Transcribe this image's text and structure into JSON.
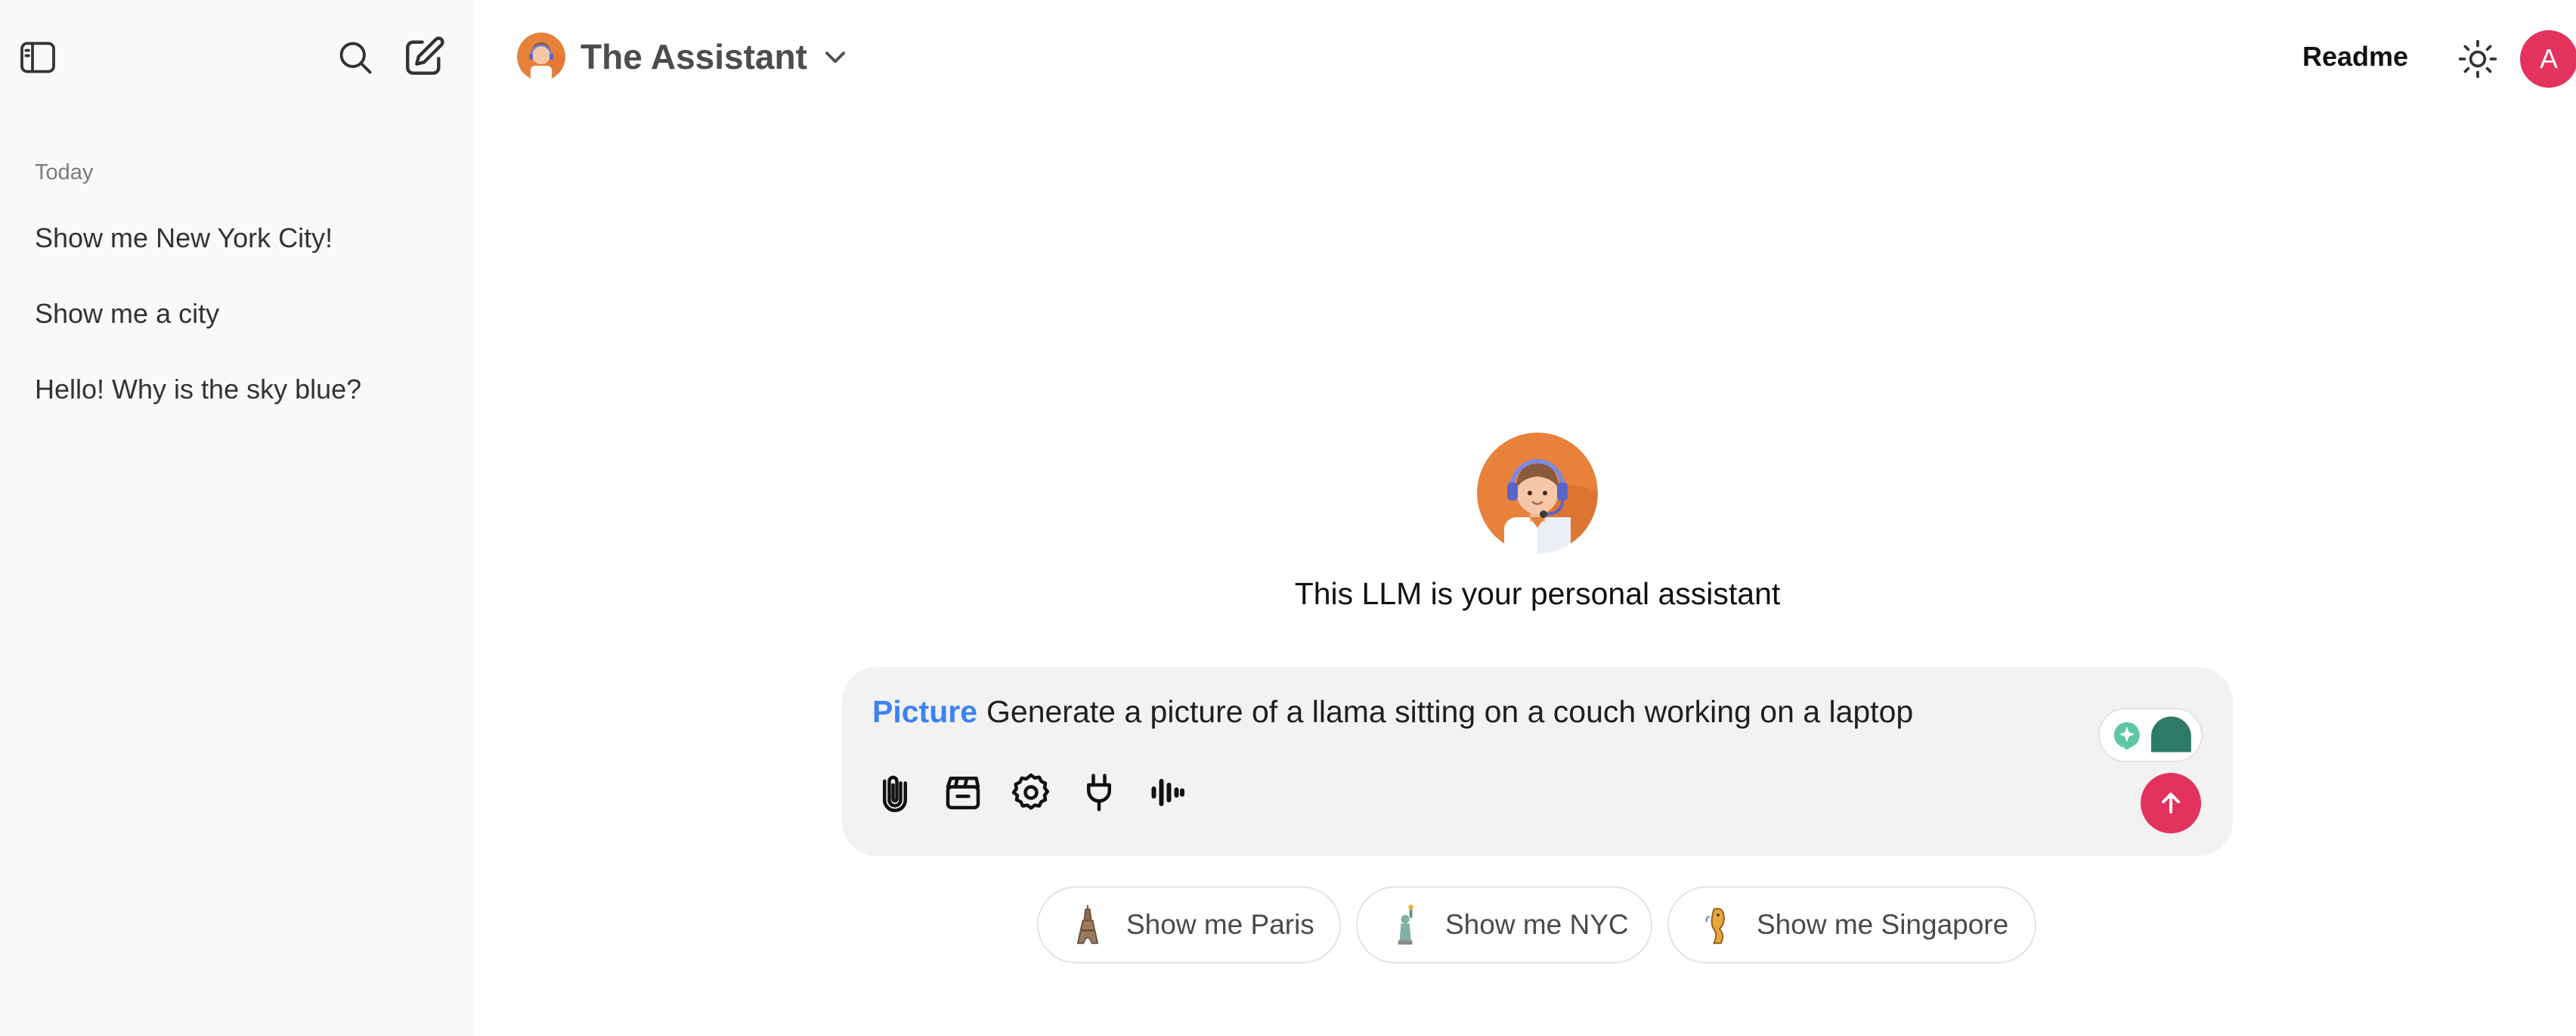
{
  "sidebar": {
    "toggle_icon": "sidebar-toggle-icon",
    "search_icon": "search-icon",
    "new_chat_icon": "new-chat-icon",
    "section_label": "Today",
    "items": [
      {
        "label": "Show me New York City!"
      },
      {
        "label": "Show me a city"
      },
      {
        "label": "Hello! Why is the sky blue?"
      }
    ]
  },
  "header": {
    "model_name": "The Assistant",
    "readme_label": "Readme",
    "theme_icon": "sun-icon",
    "user_initial": "A"
  },
  "main": {
    "description": "This LLM is your personal assistant",
    "composer": {
      "mode_label": "Picture",
      "input_text": "Generate a picture of a llama sitting on a couch working on a laptop",
      "tools": [
        "paperclip-icon",
        "clapperboard-icon",
        "gear-icon",
        "plug-icon",
        "audio-wave-icon"
      ]
    },
    "suggestions": [
      {
        "label": "Show me Paris",
        "icon": "eiffel-tower-icon"
      },
      {
        "label": "Show me NYC",
        "icon": "statue-of-liberty-icon"
      },
      {
        "label": "Show me Singapore",
        "icon": "merlion-icon"
      }
    ]
  },
  "colors": {
    "accent": "#e3325d",
    "mode_blue": "#3b82f6",
    "sidebar_bg": "#f9f9f9",
    "composer_bg": "#f2f2f2",
    "avatar_orange": "#e8813a"
  }
}
